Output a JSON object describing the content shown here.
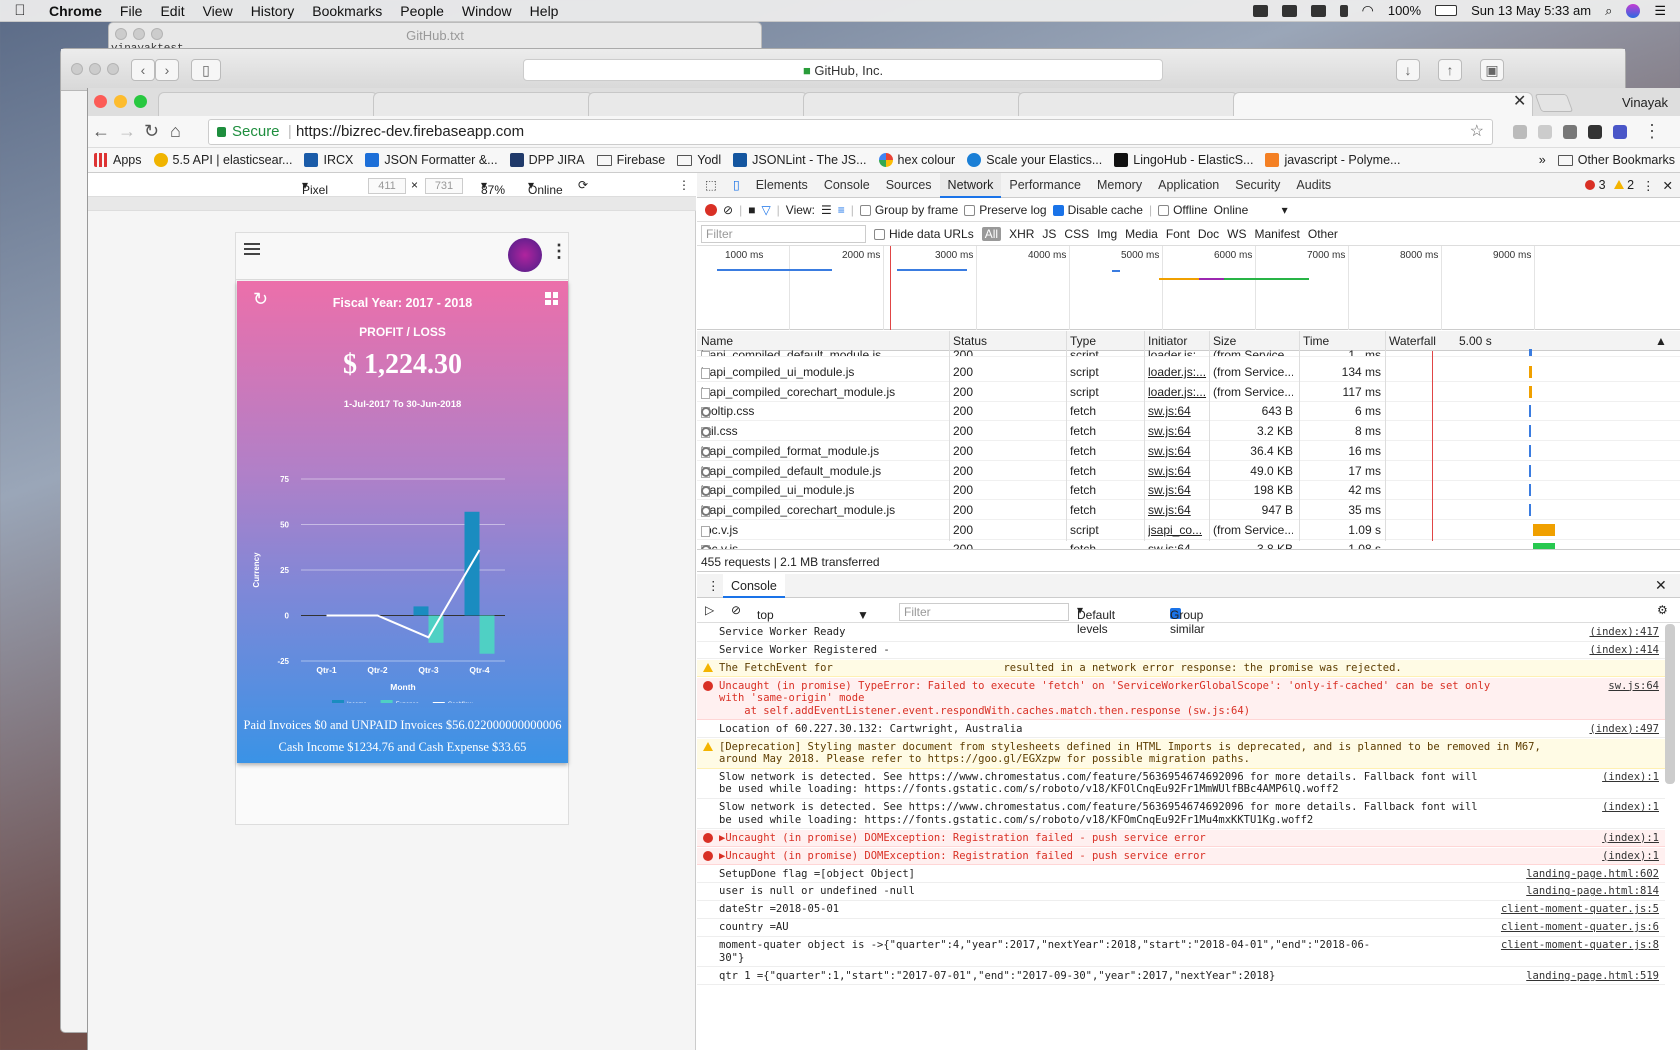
{
  "menubar": {
    "app": "Chrome",
    "items": [
      "File",
      "Edit",
      "View",
      "History",
      "Bookmarks",
      "People",
      "Window",
      "Help"
    ],
    "battery": "100%",
    "datetime": "Sun 13 May  5:33 am"
  },
  "bg_windows": {
    "github_txt_title": "GitHub.txt",
    "github_txt_text": "vinayaktest",
    "safari_url": "GitHub, Inc."
  },
  "chrome": {
    "profile": "Vinayak",
    "url_secure": "Secure",
    "url": "https://bizrec-dev.firebaseapp.com",
    "bookmarks": [
      "Apps",
      "5.5 API | elasticsear...",
      "IRCX",
      "JSON Formatter &...",
      "DPP JIRA",
      "Firebase",
      "Yodl",
      "JSONLint - The JS...",
      "hex colour",
      "Scale your Elastics...",
      "LingoHub - ElasticS...",
      "javascript - Polyme..."
    ],
    "other_bookmarks": "Other Bookmarks"
  },
  "device": {
    "name": "Pixel 2",
    "width": "411",
    "height": "731",
    "zoom": "87%",
    "network": "Online"
  },
  "app": {
    "fiscal_year": "Fiscal Year: 2017 - 2018",
    "section": "PROFIT / LOSS",
    "amount": "$  1,224.30",
    "range": "1-Jul-2017  To  30-Jun-2018",
    "footer_line1": "Paid Invoices $0 and UNPAID Invoices $56.022000000000006",
    "footer_line2": "Cash Income $1234.76 and Cash Expense $33.65"
  },
  "chart_data": {
    "type": "bar",
    "categories": [
      "Qtr-1",
      "Qtr-2",
      "Qtr-3",
      "Qtr-4"
    ],
    "xlabel": "Month",
    "ylabel": "Currency",
    "ylim": [
      -25,
      75
    ],
    "yticks": [
      -25,
      0,
      25,
      50,
      75
    ],
    "series": [
      {
        "name": "Income",
        "kind": "bar",
        "color": "#1a8cc0",
        "values": [
          0,
          0,
          5,
          57
        ]
      },
      {
        "name": "Expense",
        "kind": "bar",
        "color": "#4fd0c4",
        "values": [
          0,
          0,
          -15,
          -21
        ]
      },
      {
        "name": "Cashflow",
        "kind": "line",
        "color": "#ffffff",
        "values": [
          0,
          0,
          -12,
          36
        ]
      }
    ],
    "legend": "bottom"
  },
  "devtools": {
    "tabs": [
      "Elements",
      "Console",
      "Sources",
      "Network",
      "Performance",
      "Memory",
      "Application",
      "Security",
      "Audits"
    ],
    "active_tab": "Network",
    "errors": "3",
    "warnings": "2",
    "net_view_label": "View:",
    "group_by_frame": "Group by frame",
    "preserve_log": "Preserve log",
    "disable_cache": "Disable cache",
    "offline": "Offline",
    "throttle": "Online",
    "filter_placeholder": "Filter",
    "hide_data_urls": "Hide data URLs",
    "types": [
      "All",
      "XHR",
      "JS",
      "CSS",
      "Img",
      "Media",
      "Font",
      "Doc",
      "WS",
      "Manifest",
      "Other"
    ],
    "timeline_ticks": [
      "1000 ms",
      "2000 ms",
      "3000 ms",
      "4000 ms",
      "5000 ms",
      "6000 ms",
      "7000 ms",
      "8000 ms",
      "9000 ms"
    ],
    "columns": [
      "Name",
      "Status",
      "Type",
      "Initiator",
      "Size",
      "Time",
      "Waterfall"
    ],
    "waterfall_scale": "5.00 s",
    "rows": [
      {
        "name": "jsapi_compiled_default_module.js",
        "status": "200",
        "type": "script",
        "initiator": "loader.js:...",
        "size": "(from Service...",
        "time": "1.. ms",
        "gear": false
      },
      {
        "name": "jsapi_compiled_ui_module.js",
        "status": "200",
        "type": "script",
        "initiator": "loader.js:...",
        "size": "(from Service...",
        "time": "134 ms",
        "gear": false
      },
      {
        "name": "jsapi_compiled_corechart_module.js",
        "status": "200",
        "type": "script",
        "initiator": "loader.js:...",
        "size": "(from Service...",
        "time": "117 ms",
        "gear": false
      },
      {
        "name": "tooltip.css",
        "status": "200",
        "type": "fetch",
        "initiator": "sw.js:64",
        "size": "643 B",
        "time": "6 ms",
        "gear": true
      },
      {
        "name": "util.css",
        "status": "200",
        "type": "fetch",
        "initiator": "sw.js:64",
        "size": "3.2 KB",
        "time": "8 ms",
        "gear": true
      },
      {
        "name": "jsapi_compiled_format_module.js",
        "status": "200",
        "type": "fetch",
        "initiator": "sw.js:64",
        "size": "36.4 KB",
        "time": "16 ms",
        "gear": true
      },
      {
        "name": "jsapi_compiled_default_module.js",
        "status": "200",
        "type": "fetch",
        "initiator": "sw.js:64",
        "size": "49.0 KB",
        "time": "17 ms",
        "gear": true
      },
      {
        "name": "jsapi_compiled_ui_module.js",
        "status": "200",
        "type": "fetch",
        "initiator": "sw.js:64",
        "size": "198 KB",
        "time": "42 ms",
        "gear": true
      },
      {
        "name": "jsapi_compiled_corechart_module.js",
        "status": "200",
        "type": "fetch",
        "initiator": "sw.js:64",
        "size": "947 B",
        "time": "35 ms",
        "gear": true
      },
      {
        "name": "rpc.v.js",
        "status": "200",
        "type": "script",
        "initiator": "jsapi_co...",
        "size": "(from Service...",
        "time": "1.09 s",
        "gear": false
      },
      {
        "name": "rpc.v.js",
        "status": "200",
        "type": "fetch",
        "initiator": "sw.js:64",
        "size": "3.8 KB",
        "time": "1.08 s",
        "gear": true
      }
    ],
    "net_summary": "455 requests | 2.1 MB transferred",
    "console_title": "Console",
    "console_context": "top",
    "console_filter": "Filter",
    "console_levels": "Default levels",
    "group_similar": "Group similar",
    "console_lines": [
      {
        "level": "log",
        "msg": "Service Worker Ready",
        "src": "(index):417"
      },
      {
        "level": "log",
        "msg": "Service Worker Registered -",
        "src": "(index):414"
      },
      {
        "level": "warn",
        "msg": "The FetchEvent for                           resulted in a network error response: the promise was rejected.",
        "src": ""
      },
      {
        "level": "err",
        "msg": "Uncaught (in promise) TypeError: Failed to execute 'fetch' on 'ServiceWorkerGlobalScope': 'only-if-cached' can be set only\nwith 'same-origin' mode\n    at self.addEventListener.event.respondWith.caches.match.then.response (sw.js:64)",
        "src": "sw.js:64"
      },
      {
        "level": "log",
        "msg": "Location of 60.227.30.132: Cartwright, Australia",
        "src": "(index):497"
      },
      {
        "level": "warn",
        "msg": "[Deprecation] Styling master document from stylesheets defined in HTML Imports is deprecated, and is planned to be removed in M67,\naround May 2018. Please refer to https://goo.gl/EGXzpw for possible migration paths.",
        "src": ""
      },
      {
        "level": "log",
        "msg": "Slow network is detected. See https://www.chromestatus.com/feature/5636954674692096 for more details. Fallback font will\nbe used while loading: https://fonts.gstatic.com/s/roboto/v18/KFOlCnqEu92Fr1MmWUlfBBc4AMP6lQ.woff2",
        "src": "(index):1"
      },
      {
        "level": "log",
        "msg": "Slow network is detected. See https://www.chromestatus.com/feature/5636954674692096 for more details. Fallback font will\nbe used while loading: https://fonts.gstatic.com/s/roboto/v18/KFOmCnqEu92Fr1Mu4mxKKTU1Kg.woff2",
        "src": "(index):1"
      },
      {
        "level": "err",
        "msg": "▶Uncaught (in promise) DOMException: Registration failed - push service error",
        "src": "(index):1"
      },
      {
        "level": "err",
        "msg": "▶Uncaught (in promise) DOMException: Registration failed - push service error",
        "src": "(index):1"
      },
      {
        "level": "log",
        "msg": "SetupDone flag =[object Object]",
        "src": "landing-page.html:602"
      },
      {
        "level": "log",
        "msg": "user is null or undefined -null",
        "src": "landing-page.html:814"
      },
      {
        "level": "log",
        "msg": "dateStr =2018-05-01",
        "src": "client-moment-quater.js:5"
      },
      {
        "level": "log",
        "msg": "country =AU",
        "src": "client-moment-quater.js:6"
      },
      {
        "level": "log",
        "msg": "moment-quater object is ->{\"quarter\":4,\"year\":2017,\"nextYear\":2018,\"start\":\"2018-04-01\",\"end\":\"2018-06-\n30\"}",
        "src": "client-moment-quater.js:8"
      },
      {
        "level": "log",
        "msg": "qtr 1 ={\"quarter\":1,\"start\":\"2017-07-01\",\"end\":\"2017-09-30\",\"year\":2017,\"nextYear\":2018}",
        "src": "landing-page.html:519"
      }
    ]
  }
}
